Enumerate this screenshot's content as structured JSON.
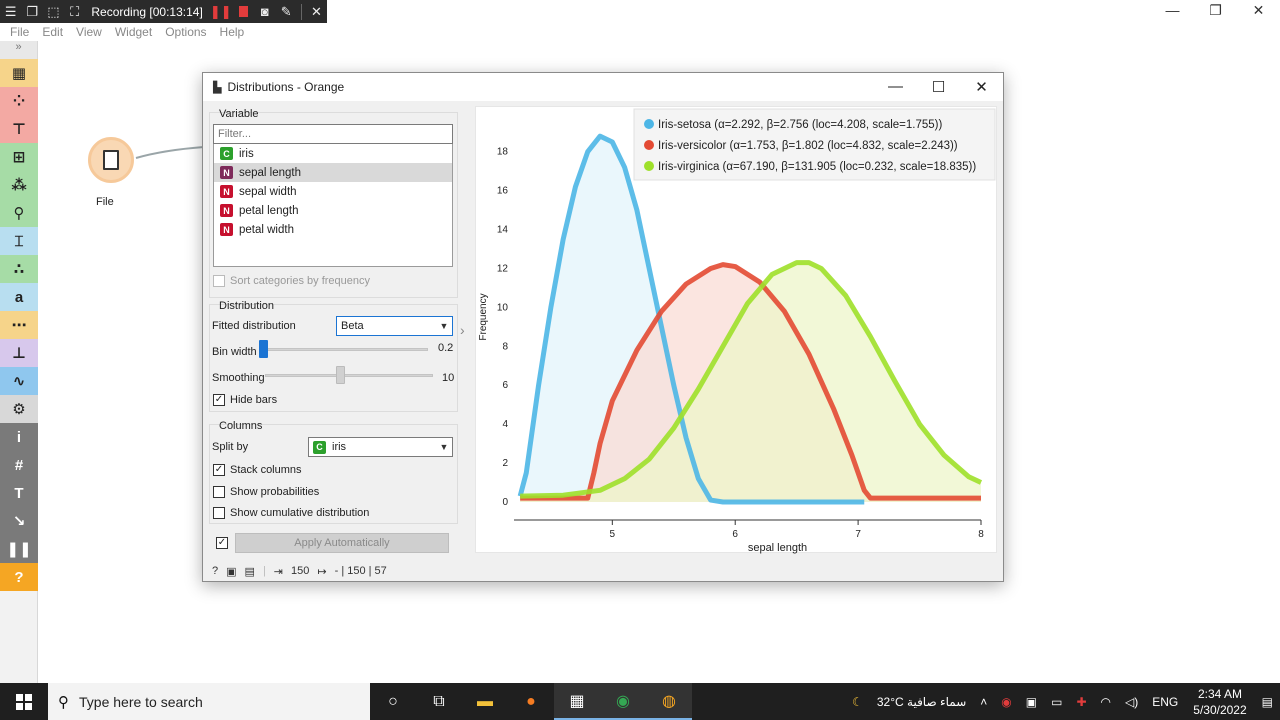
{
  "recorder": {
    "title": "Recording [00:13:14]"
  },
  "menu": [
    "File",
    "Edit",
    "View",
    "Widget",
    "Options",
    "Help"
  ],
  "canvas": {
    "file_widget_label": "File"
  },
  "dialog": {
    "title": "Distributions - Orange",
    "variable_section": "Variable",
    "filter_placeholder": "Filter...",
    "variables": [
      {
        "badge": "C",
        "name": "iris",
        "color": "#2ca02c"
      },
      {
        "badge": "N",
        "name": "sepal length",
        "color": "#7e2a5a"
      },
      {
        "badge": "N",
        "name": "sepal width",
        "color": "#c6102e"
      },
      {
        "badge": "N",
        "name": "petal length",
        "color": "#c6102e"
      },
      {
        "badge": "N",
        "name": "petal width",
        "color": "#c6102e"
      }
    ],
    "sort_label": "Sort categories by frequency",
    "distribution_section": "Distribution",
    "fitted_label": "Fitted distribution",
    "fitted_value": "Beta",
    "bin_width_label": "Bin width",
    "bin_width_value": "0.2",
    "smoothing_label": "Smoothing",
    "smoothing_value": "10",
    "hide_bars_label": "Hide bars",
    "columns_section": "Columns",
    "split_by_label": "Split by",
    "split_by_value": "iris",
    "stack_columns_label": "Stack columns",
    "show_prob_label": "Show probabilities",
    "show_cum_label": "Show cumulative distribution",
    "apply_label": "Apply Automatically",
    "status_in": "150",
    "status_out": "- | 150 | 57"
  },
  "chart_data": {
    "type": "area",
    "xlabel": "sepal length",
    "ylabel": "Frequency",
    "xlim": [
      4.2,
      8.0
    ],
    "ylim": [
      0,
      18.5
    ],
    "xticks": [
      "5",
      "6",
      "7",
      "8"
    ],
    "yticks": [
      "0",
      "2",
      "4",
      "6",
      "8",
      "10",
      "12",
      "14",
      "16",
      "18"
    ],
    "legend_position": "top-right",
    "series": [
      {
        "name": "Iris-setosa (α=2.292, β=2.756 (loc=4.208, scale=1.755))",
        "color": "#4db6e6",
        "fill": "#e3f4fb",
        "x": [
          4.25,
          4.3,
          4.4,
          4.5,
          4.6,
          4.7,
          4.8,
          4.9,
          5.0,
          5.1,
          5.2,
          5.3,
          5.4,
          5.5,
          5.6,
          5.7,
          5.8,
          5.9,
          6.0,
          7.05
        ],
        "y": [
          0.3,
          1.5,
          6.0,
          10.0,
          13.5,
          16.2,
          18.0,
          18.8,
          18.5,
          17.2,
          15.0,
          12.0,
          9.0,
          6.0,
          3.3,
          1.2,
          0.1,
          0.0,
          0.0,
          0.0
        ]
      },
      {
        "name": "Iris-versicolor (α=1.753, β=1.802 (loc=4.832, scale=2.243))",
        "color": "#e34a33",
        "fill": "#f9dcd6",
        "x": [
          4.25,
          4.8,
          4.85,
          4.9,
          5.0,
          5.2,
          5.4,
          5.6,
          5.8,
          5.9,
          6.0,
          6.2,
          6.4,
          6.6,
          6.8,
          6.95,
          7.05,
          7.1,
          8.0
        ],
        "y": [
          0.2,
          0.2,
          1.5,
          3.0,
          5.2,
          7.8,
          9.8,
          11.2,
          12.0,
          12.2,
          12.1,
          11.3,
          9.8,
          7.6,
          4.8,
          2.4,
          0.6,
          0.2,
          0.2
        ]
      },
      {
        "name": "Iris-virginica (α=67.190, β=131.905 (loc=0.232, scale=18.835))",
        "color": "#9ee02a",
        "fill": "#eef5c9",
        "x": [
          4.25,
          4.6,
          4.9,
          5.1,
          5.3,
          5.5,
          5.7,
          5.9,
          6.1,
          6.3,
          6.5,
          6.6,
          6.7,
          6.9,
          7.1,
          7.3,
          7.5,
          7.7,
          7.9,
          8.0
        ],
        "y": [
          0.3,
          0.35,
          0.6,
          1.2,
          2.2,
          3.8,
          5.8,
          8.0,
          10.2,
          11.7,
          12.3,
          12.3,
          12.0,
          10.6,
          8.5,
          6.2,
          4.0,
          2.4,
          1.3,
          1.0
        ]
      }
    ]
  },
  "taskbar": {
    "search_placeholder": "Type here to search",
    "weather": "32°C  سماء صافية",
    "lang": "ENG",
    "time": "2:34 AM",
    "date": "5/30/2022"
  }
}
